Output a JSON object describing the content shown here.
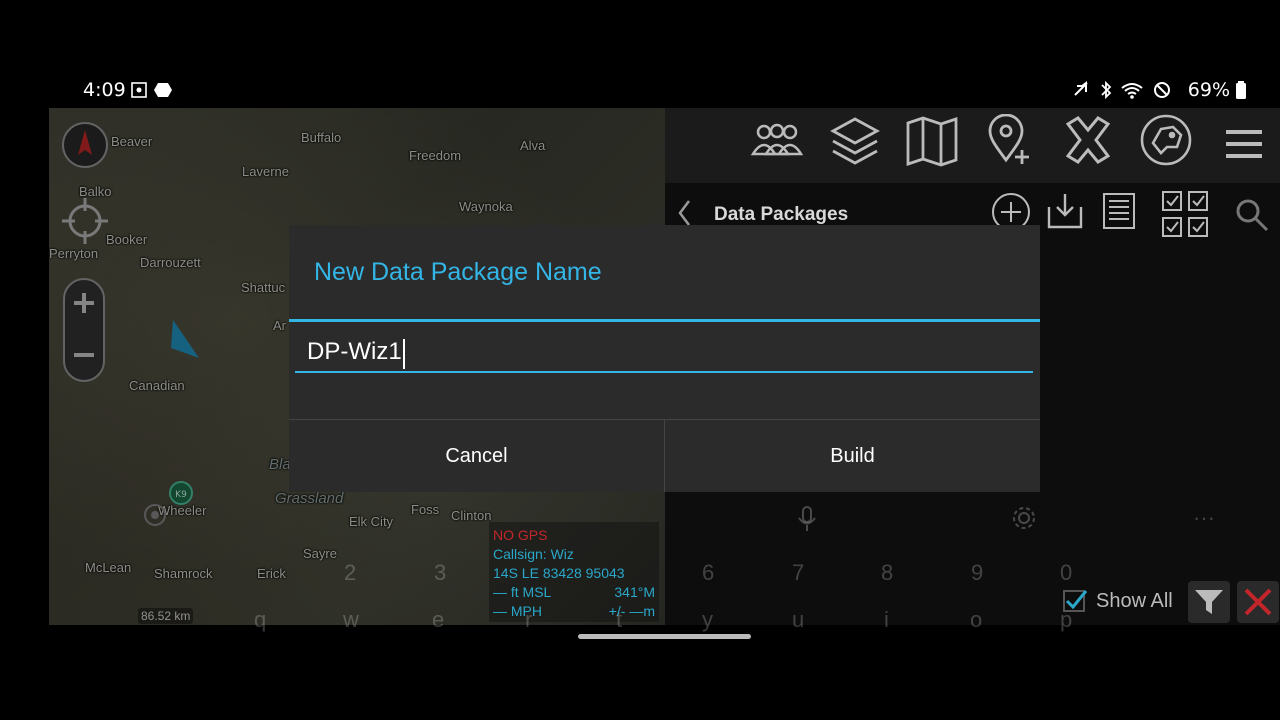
{
  "status_bar": {
    "time": "4:09",
    "battery": "69%",
    "icons": [
      "screenshot-icon",
      "notification-icon",
      "mute-icon",
      "bluetooth-icon",
      "wifi-icon",
      "do-not-disturb-icon",
      "battery-icon"
    ]
  },
  "map": {
    "towns": [
      "Beaver",
      "Buffalo",
      "Alva",
      "Laverne",
      "Freedom",
      "Balko",
      "Booker",
      "Waynoka",
      "Perryton",
      "Darrouzett",
      "Shattuc",
      "Canadian",
      "Wheeler",
      "Elk City",
      "Foss",
      "Clinton",
      "Sayre",
      "McLean",
      "Shamrock",
      "Erick",
      "Grassland",
      "Ar",
      "Bla"
    ],
    "scale": "86.52 km",
    "info": {
      "gps": "NO GPS",
      "callsign": "Callsign: Wiz",
      "grid": "14S  LE  83428  95043",
      "altitude": "— ft MSL",
      "heading": "341°M",
      "speed": "— MPH",
      "accuracy": "+/- —m"
    }
  },
  "toolbar": {
    "icons": [
      "contacts-icon",
      "layers-icon",
      "map-icon",
      "add-point-icon",
      "close-tool-icon",
      "ronin-dog-icon",
      "menu-icon"
    ]
  },
  "panel": {
    "title": "Data Packages",
    "show_all": "Show All"
  },
  "dialog": {
    "title": "New Data Package Name",
    "input_value": "DP-Wiz1",
    "cancel_label": "Cancel",
    "build_label": "Build"
  },
  "keyboard": {
    "numbers": [
      "2",
      "3",
      "6",
      "7",
      "8",
      "9",
      "0"
    ],
    "letters": [
      "q",
      "w",
      "e",
      "r",
      "t",
      "y",
      "u",
      "i",
      "o",
      "p"
    ]
  },
  "colors": {
    "accent": "#33b5e5",
    "dialog_bg": "#2b2b2b",
    "toolbar_bg": "#1b1b1b",
    "info_text": "#2aa7c9",
    "alert_red": "#c2262b"
  }
}
